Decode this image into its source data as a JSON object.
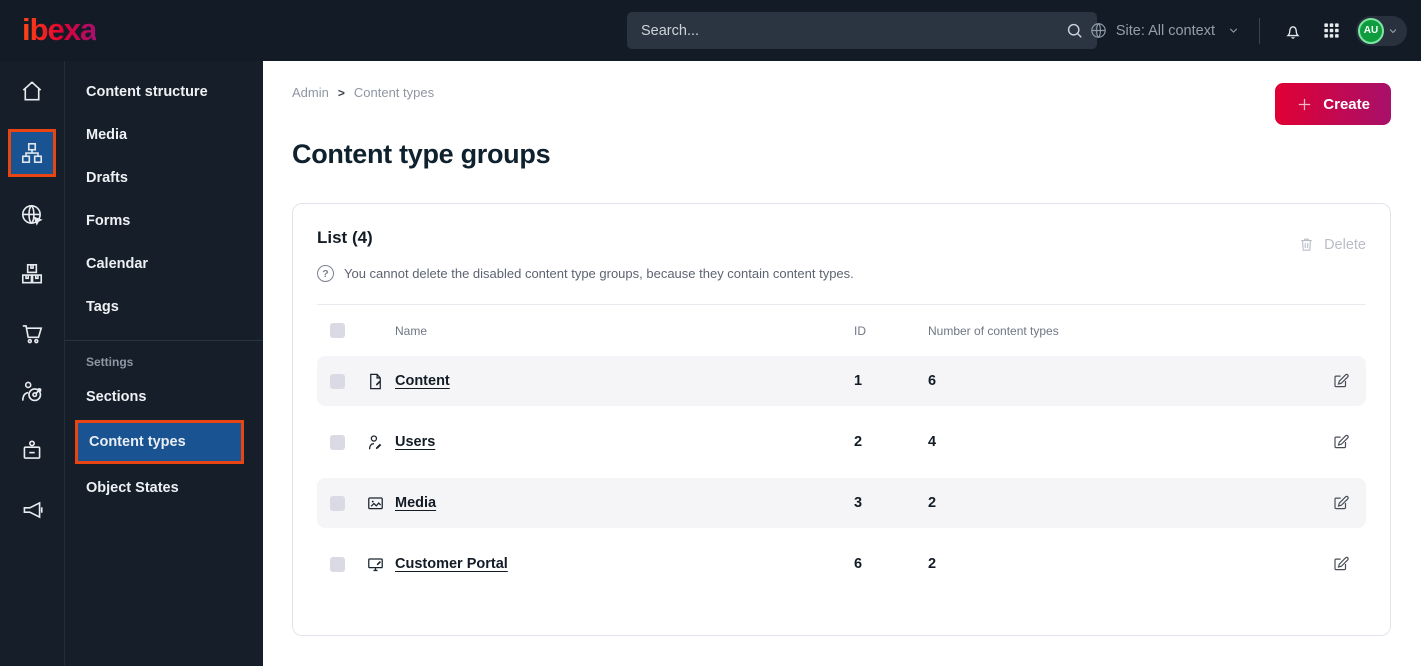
{
  "topbar": {
    "logo": "ibexa",
    "search_placeholder": "Search...",
    "site_context": "Site: All context",
    "avatar_initials": "AU",
    "icons": [
      "globe-icon",
      "bell-icon",
      "app-grid-icon",
      "search-icon",
      "chevron-down-icon"
    ]
  },
  "icon_rail": {
    "items": [
      {
        "icon": "home-icon",
        "active": false
      },
      {
        "icon": "content-structure-icon",
        "active": true,
        "annotated": true
      },
      {
        "icon": "site-globe-icon",
        "active": false
      },
      {
        "icon": "products-icon",
        "active": false
      },
      {
        "icon": "cart-icon",
        "active": false
      },
      {
        "icon": "personalization-icon",
        "active": false
      },
      {
        "icon": "admin-badge-icon",
        "active": false
      },
      {
        "icon": "megaphone-icon",
        "active": false
      }
    ]
  },
  "sidebar": {
    "items": [
      "Content structure",
      "Media",
      "Drafts",
      "Forms",
      "Calendar",
      "Tags"
    ],
    "settings_label": "Settings",
    "settings_items": [
      "Sections",
      "Content types",
      "Object States"
    ],
    "active_item": "Content types"
  },
  "main": {
    "breadcrumb": {
      "items": [
        "Admin",
        "Content types"
      ],
      "separator": ">"
    },
    "create_label": "Create",
    "page_title": "Content type groups",
    "list": {
      "title": "List (4)",
      "hint": "You cannot delete the disabled content type groups, because they contain content types.",
      "delete_label": "Delete",
      "columns": [
        "Name",
        "ID",
        "Number of content types"
      ],
      "rows": [
        {
          "icon": "file-icon",
          "name": "Content",
          "id": "1",
          "count": "6"
        },
        {
          "icon": "user-icon",
          "name": "Users",
          "id": "2",
          "count": "4"
        },
        {
          "icon": "image-icon",
          "name": "Media",
          "id": "3",
          "count": "2"
        },
        {
          "icon": "monitor-icon",
          "name": "Customer Portal",
          "id": "6",
          "count": "2"
        }
      ]
    }
  },
  "colors": {
    "topbar_bg": "#131c26",
    "sidebar_bg": "#151e29",
    "active_blue": "#1a5391",
    "annotation_orange": "#e84512",
    "brand_gradient_start": "#e00034",
    "brand_gradient_end": "#a8106a",
    "avatar_green": "#0e9c3f",
    "row_alt_bg": "#f5f5f8"
  }
}
